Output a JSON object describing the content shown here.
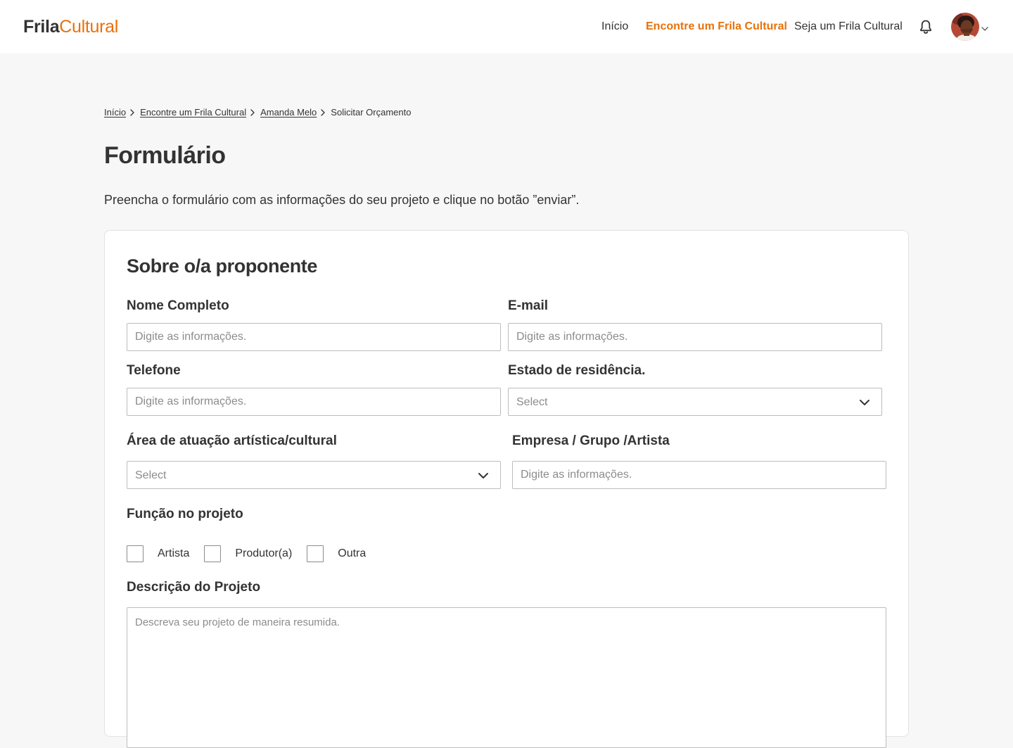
{
  "header": {
    "logo": {
      "part1": "Frila",
      "part2": "Cultural"
    },
    "nav": [
      {
        "label": "Início",
        "active": false
      },
      {
        "label": "Encontre um Frila Cultural",
        "active": true
      },
      {
        "label": "Seja um Frila Cultural",
        "active": false
      }
    ],
    "icons": {
      "notifications": "bell-icon",
      "account_menu": "chevron-down-icon"
    },
    "accent_color": "#e8710a"
  },
  "breadcrumb": [
    {
      "label": "Início",
      "link": true
    },
    {
      "label": "Encontre um Frila Cultural",
      "link": true
    },
    {
      "label": "Amanda Melo",
      "link": true
    },
    {
      "label": "Solicitar Orçamento",
      "link": false
    }
  ],
  "page": {
    "title": "Formulário",
    "intro": "Preencha o formulário com as informações do seu projeto e clique no botão ”enviar”."
  },
  "form": {
    "section_title": "Sobre o/a proponente",
    "fields": {
      "nome": {
        "label": "Nome Completo",
        "placeholder": "Digite as informações.",
        "value": ""
      },
      "email": {
        "label": "E-mail",
        "placeholder": "Digite as informações.",
        "value": ""
      },
      "telefone": {
        "label": "Telefone",
        "placeholder": "Digite as informações.",
        "value": ""
      },
      "estado": {
        "label": "Estado de residência.",
        "selected": "Select"
      },
      "area": {
        "label": "Área de atuação artística/cultural",
        "selected": "Select"
      },
      "empresa": {
        "label": "Empresa / Grupo /Artista",
        "placeholder": "Digite as informações.",
        "value": ""
      },
      "funcao": {
        "label": "Função no projeto",
        "options": [
          {
            "label": "Artista",
            "checked": false
          },
          {
            "label": "Produtor(a)",
            "checked": false
          },
          {
            "label": "Outra",
            "checked": false
          }
        ]
      },
      "descricao": {
        "label": "Descrição do Projeto",
        "placeholder": "Descreva seu projeto de maneira resumida.",
        "value": ""
      }
    }
  }
}
